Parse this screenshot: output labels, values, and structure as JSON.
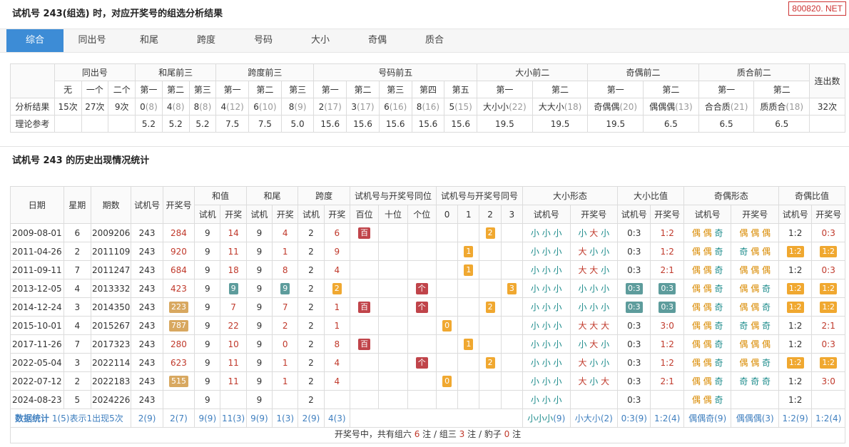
{
  "watermark": "800820. NET",
  "section1": {
    "title": "试机号 243(组选) 时，对应开奖号的组选分析结果",
    "tabs": [
      "综合",
      "同出号",
      "和尾",
      "跨度",
      "号码",
      "大小",
      "奇偶",
      "质合"
    ],
    "active_tab": 0,
    "groups": [
      "同出号",
      "和尾前三",
      "跨度前三",
      "号码前五",
      "大小前二",
      "奇偶前二",
      "质合前二",
      "连出数"
    ],
    "subheaders": [
      "无",
      "一个",
      "二个",
      "第一",
      "第二",
      "第三",
      "第一",
      "第二",
      "第三",
      "第一",
      "第二",
      "第三",
      "第四",
      "第五",
      "第一",
      "第二",
      "第一",
      "第二",
      "第一",
      "第二"
    ],
    "row_analysis_label": "分析结果",
    "row_theory_label": "理论参考",
    "analysis": [
      {
        "v": "15次",
        "c": ""
      },
      {
        "v": "27次",
        "c": ""
      },
      {
        "v": "9次",
        "c": ""
      },
      {
        "v": "0",
        "c": "(8)"
      },
      {
        "v": "4",
        "c": "(8)"
      },
      {
        "v": "8",
        "c": "(8)"
      },
      {
        "v": "4",
        "c": "(12)"
      },
      {
        "v": "6",
        "c": "(10)"
      },
      {
        "v": "8",
        "c": "(9)"
      },
      {
        "v": "2",
        "c": "(17)"
      },
      {
        "v": "3",
        "c": "(17)"
      },
      {
        "v": "6",
        "c": "(16)"
      },
      {
        "v": "8",
        "c": "(16)"
      },
      {
        "v": "5",
        "c": "(15)"
      },
      {
        "v": "大小小",
        "c": "(22)"
      },
      {
        "v": "大大小",
        "c": "(18)"
      },
      {
        "v": "奇偶偶",
        "c": "(20)"
      },
      {
        "v": "偶偶偶",
        "c": "(13)"
      },
      {
        "v": "合合质",
        "c": "(21)"
      },
      {
        "v": "质质合",
        "c": "(18)"
      },
      {
        "v": "32次",
        "c": ""
      }
    ],
    "theory": [
      "",
      "",
      "",
      "5.2",
      "5.2",
      "5.2",
      "7.5",
      "7.5",
      "5.0",
      "15.6",
      "15.6",
      "15.6",
      "15.6",
      "15.6",
      "19.5",
      "19.5",
      "19.5",
      "6.5",
      "6.5",
      "6.5",
      ""
    ]
  },
  "section2": {
    "title": "试机号 243 的历史出现情况统计",
    "headers_top": [
      "日期",
      "星期",
      "期数",
      "试机号",
      "开奖号",
      "和值",
      "和尾",
      "跨度",
      "试机号与开奖号同位",
      "试机号与开奖号同号",
      "大小形态",
      "大小比值",
      "奇偶形态",
      "奇偶比值"
    ],
    "headers_sub": [
      "试机",
      "开奖",
      "试机",
      "开奖",
      "试机",
      "开奖",
      "百位",
      "十位",
      "个位",
      "0",
      "1",
      "2",
      "3",
      "试机号",
      "开奖号",
      "试机号",
      "开奖号",
      "试机号",
      "开奖号",
      "试机号",
      "开奖号"
    ],
    "rows": [
      {
        "date": "2009-08-01",
        "wk": "6",
        "issue": "2009206",
        "test": "243",
        "draw": "284",
        "draw_hl": false,
        "sum_t": "9",
        "sum_d": "14",
        "sum_hl": false,
        "tail_t": "9",
        "tail_d": "4",
        "tail_hl": false,
        "span_t": "2",
        "span_d": "6",
        "span_hl": false,
        "pos": [
          "百",
          "",
          ""
        ],
        "same": [
          "",
          "",
          "2",
          ""
        ],
        "bs_t": "小 小 小",
        "bs_d": "小 大 小",
        "bsr_t": "0:3",
        "bsr_d": "1:2",
        "bsr_hl": false,
        "oe_t": "偶 偶 奇",
        "oe_d": "偶 偶 偶",
        "oer_t": "1:2",
        "oer_d": "0:3",
        "oer_hl": false
      },
      {
        "date": "2011-04-26",
        "wk": "2",
        "issue": "2011109",
        "test": "243",
        "draw": "920",
        "draw_hl": false,
        "sum_t": "9",
        "sum_d": "11",
        "sum_hl": false,
        "tail_t": "9",
        "tail_d": "1",
        "tail_hl": false,
        "span_t": "2",
        "span_d": "9",
        "span_hl": false,
        "pos": [
          "",
          "",
          ""
        ],
        "same": [
          "",
          "1",
          "",
          ""
        ],
        "bs_t": "小 小 小",
        "bs_d": "大 小 小",
        "bsr_t": "0:3",
        "bsr_d": "1:2",
        "bsr_hl": false,
        "oe_t": "偶 偶 奇",
        "oe_d": "奇 偶 偶",
        "oer_t": "1:2",
        "oer_d": "1:2",
        "oer_hl": true
      },
      {
        "date": "2011-09-11",
        "wk": "7",
        "issue": "2011247",
        "test": "243",
        "draw": "684",
        "draw_hl": false,
        "sum_t": "9",
        "sum_d": "18",
        "sum_hl": false,
        "tail_t": "9",
        "tail_d": "8",
        "tail_hl": false,
        "span_t": "2",
        "span_d": "4",
        "span_hl": false,
        "pos": [
          "",
          "",
          ""
        ],
        "same": [
          "",
          "1",
          "",
          ""
        ],
        "bs_t": "小 小 小",
        "bs_d": "大 大 小",
        "bsr_t": "0:3",
        "bsr_d": "2:1",
        "bsr_hl": false,
        "oe_t": "偶 偶 奇",
        "oe_d": "偶 偶 偶",
        "oer_t": "1:2",
        "oer_d": "0:3",
        "oer_hl": false
      },
      {
        "date": "2013-12-05",
        "wk": "4",
        "issue": "2013332",
        "test": "243",
        "draw": "423",
        "draw_hl": false,
        "sum_t": "9",
        "sum_d": "9",
        "sum_hl": true,
        "tail_t": "9",
        "tail_d": "9",
        "tail_hl": true,
        "span_t": "2",
        "span_d": "2",
        "span_hl": true,
        "pos": [
          "",
          "",
          "个"
        ],
        "same": [
          "",
          "",
          "",
          "3"
        ],
        "bs_t": "小 小 小",
        "bs_d": "小 小 小",
        "bsr_t": "0:3",
        "bsr_d": "0:3",
        "bsr_hl": true,
        "oe_t": "偶 偶 奇",
        "oe_d": "偶 偶 奇",
        "oer_t": "1:2",
        "oer_d": "1:2",
        "oer_hl": true
      },
      {
        "date": "2014-12-24",
        "wk": "3",
        "issue": "2014350",
        "test": "243",
        "draw": "223",
        "draw_hl": true,
        "sum_t": "9",
        "sum_d": "7",
        "sum_hl": false,
        "tail_t": "9",
        "tail_d": "7",
        "tail_hl": false,
        "span_t": "2",
        "span_d": "1",
        "span_hl": false,
        "pos": [
          "百",
          "",
          "个"
        ],
        "same": [
          "",
          "",
          "2",
          ""
        ],
        "bs_t": "小 小 小",
        "bs_d": "小 小 小",
        "bsr_t": "0:3",
        "bsr_d": "0:3",
        "bsr_hl": true,
        "oe_t": "偶 偶 奇",
        "oe_d": "偶 偶 奇",
        "oer_t": "1:2",
        "oer_d": "1:2",
        "oer_hl": true
      },
      {
        "date": "2015-10-01",
        "wk": "4",
        "issue": "2015267",
        "test": "243",
        "draw": "787",
        "draw_hl": true,
        "sum_t": "9",
        "sum_d": "22",
        "sum_hl": false,
        "tail_t": "9",
        "tail_d": "2",
        "tail_hl": false,
        "span_t": "2",
        "span_d": "1",
        "span_hl": false,
        "pos": [
          "",
          "",
          ""
        ],
        "same": [
          "0",
          "",
          "",
          ""
        ],
        "bs_t": "小 小 小",
        "bs_d": "大 大 大",
        "bsr_t": "0:3",
        "bsr_d": "3:0",
        "bsr_hl": false,
        "oe_t": "偶 偶 奇",
        "oe_d": "奇 偶 奇",
        "oer_t": "1:2",
        "oer_d": "2:1",
        "oer_hl": false
      },
      {
        "date": "2017-11-26",
        "wk": "7",
        "issue": "2017323",
        "test": "243",
        "draw": "280",
        "draw_hl": false,
        "sum_t": "9",
        "sum_d": "10",
        "sum_hl": false,
        "tail_t": "9",
        "tail_d": "0",
        "tail_hl": false,
        "span_t": "2",
        "span_d": "8",
        "span_hl": false,
        "pos": [
          "百",
          "",
          ""
        ],
        "same": [
          "",
          "1",
          "",
          ""
        ],
        "bs_t": "小 小 小",
        "bs_d": "小 大 小",
        "bsr_t": "0:3",
        "bsr_d": "1:2",
        "bsr_hl": false,
        "oe_t": "偶 偶 奇",
        "oe_d": "偶 偶 偶",
        "oer_t": "1:2",
        "oer_d": "0:3",
        "oer_hl": false
      },
      {
        "date": "2022-05-04",
        "wk": "3",
        "issue": "2022114",
        "test": "243",
        "draw": "623",
        "draw_hl": false,
        "sum_t": "9",
        "sum_d": "11",
        "sum_hl": false,
        "tail_t": "9",
        "tail_d": "1",
        "tail_hl": false,
        "span_t": "2",
        "span_d": "4",
        "span_hl": false,
        "pos": [
          "",
          "",
          "个"
        ],
        "same": [
          "",
          "",
          "2",
          ""
        ],
        "bs_t": "小 小 小",
        "bs_d": "大 小 小",
        "bsr_t": "0:3",
        "bsr_d": "1:2",
        "bsr_hl": false,
        "oe_t": "偶 偶 奇",
        "oe_d": "偶 偶 奇",
        "oer_t": "1:2",
        "oer_d": "1:2",
        "oer_hl": true
      },
      {
        "date": "2022-07-12",
        "wk": "2",
        "issue": "2022183",
        "test": "243",
        "draw": "515",
        "draw_hl": true,
        "sum_t": "9",
        "sum_d": "11",
        "sum_hl": false,
        "tail_t": "9",
        "tail_d": "1",
        "tail_hl": false,
        "span_t": "2",
        "span_d": "4",
        "span_hl": false,
        "pos": [
          "",
          "",
          ""
        ],
        "same": [
          "0",
          "",
          "",
          ""
        ],
        "bs_t": "小 小 小",
        "bs_d": "大 小 大",
        "bsr_t": "0:3",
        "bsr_d": "2:1",
        "bsr_hl": false,
        "oe_t": "偶 偶 奇",
        "oe_d": "奇 奇 奇",
        "oer_t": "1:2",
        "oer_d": "3:0",
        "oer_hl": false
      },
      {
        "date": "2024-08-23",
        "wk": "5",
        "issue": "2024226",
        "test": "243",
        "draw": "",
        "draw_hl": false,
        "sum_t": "9",
        "sum_d": "",
        "sum_hl": false,
        "tail_t": "9",
        "tail_d": "",
        "tail_hl": false,
        "span_t": "2",
        "span_d": "",
        "span_hl": false,
        "pos": [
          "",
          "",
          ""
        ],
        "same": [
          "",
          "",
          "",
          ""
        ],
        "bs_t": "小 小 小",
        "bs_d": "",
        "bsr_t": "0:3",
        "bsr_d": "",
        "bsr_hl": false,
        "oe_t": "偶 偶 奇",
        "oe_d": "",
        "oer_t": "1:2",
        "oer_d": "",
        "oer_hl": false
      }
    ],
    "stats": {
      "label": "数据统计",
      "legend": "1(5)表示1出现5次",
      "cells": [
        {
          "v": "2",
          "c": "(9)"
        },
        {
          "v": "2",
          "c": "(7)"
        },
        {
          "v": "9",
          "c": "(9)"
        },
        {
          "v": "11",
          "c": "(3)"
        },
        {
          "v": "9",
          "c": "(9)"
        },
        {
          "v": "1",
          "c": "(3)"
        },
        {
          "v": "2",
          "c": "(9)"
        },
        {
          "v": "4",
          "c": "(3)"
        },
        {
          "v": "小小小",
          "c": "(9)"
        },
        {
          "v": "小大小",
          "c": "(2)"
        },
        {
          "v": "0:3",
          "c": "(9)"
        },
        {
          "v": "1:2",
          "c": "(4)"
        },
        {
          "v": "偶偶奇",
          "c": "(9)"
        },
        {
          "v": "偶偶偶",
          "c": "(3)"
        },
        {
          "v": "1:2",
          "c": "(9)"
        },
        {
          "v": "1:2",
          "c": "(4)"
        }
      ]
    },
    "summary": {
      "prefix": "开奖号中，共有组六",
      "g6": "6",
      "mid1": "注 / 组三",
      "g3": "3",
      "mid2": "注 / 豹子",
      "bz": "0",
      "suffix": "注"
    }
  }
}
